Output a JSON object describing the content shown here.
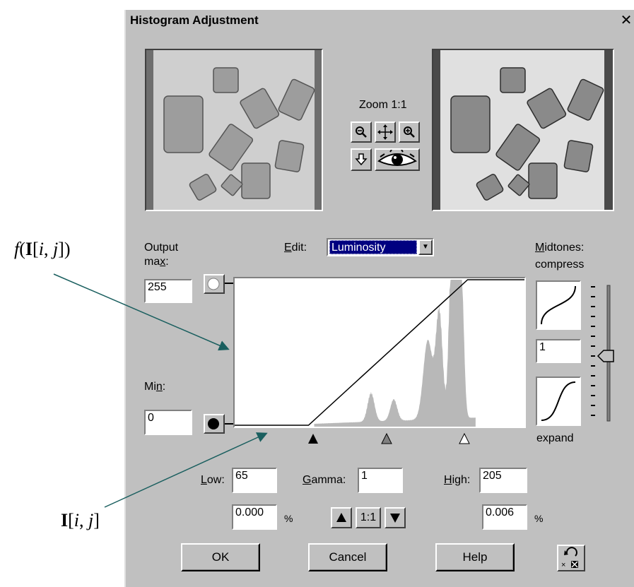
{
  "window": {
    "title": "Histogram Adjustment",
    "close_glyph": "✕"
  },
  "zoom": {
    "label": "Zoom 1:1"
  },
  "edit": {
    "label": "Edit:",
    "value": "Luminosity"
  },
  "output_max": {
    "label_line1": "Output",
    "label_line2": "max:",
    "value": "255"
  },
  "min": {
    "label": "Min:",
    "value": "0"
  },
  "midtones": {
    "title": "Midtones:",
    "compress_label": "compress",
    "value": "1",
    "expand_label": "expand"
  },
  "levels": {
    "low_label": "Low:",
    "low_value": "65",
    "gamma_label": "Gamma:",
    "gamma_value": "1",
    "high_label": "High:",
    "high_value": "205",
    "low_percent": "0.000",
    "high_percent": "0.006",
    "percent_sign": "%",
    "reset_ratio": "1:1"
  },
  "buttons": {
    "ok": "OK",
    "cancel": "Cancel",
    "help": "Help"
  },
  "annotations": {
    "output": "f(I[i, j])",
    "input": "I[i, j]",
    "arrow_color": "#1a5f5f"
  },
  "curve": {
    "low_input": 65,
    "high_input": 205,
    "output_min": 0,
    "output_max": 255
  },
  "icons": [
    "zoom-out-icon",
    "pan-icon",
    "zoom-in-icon",
    "down-arrow-icon",
    "eye-icon",
    "undo-icon"
  ]
}
